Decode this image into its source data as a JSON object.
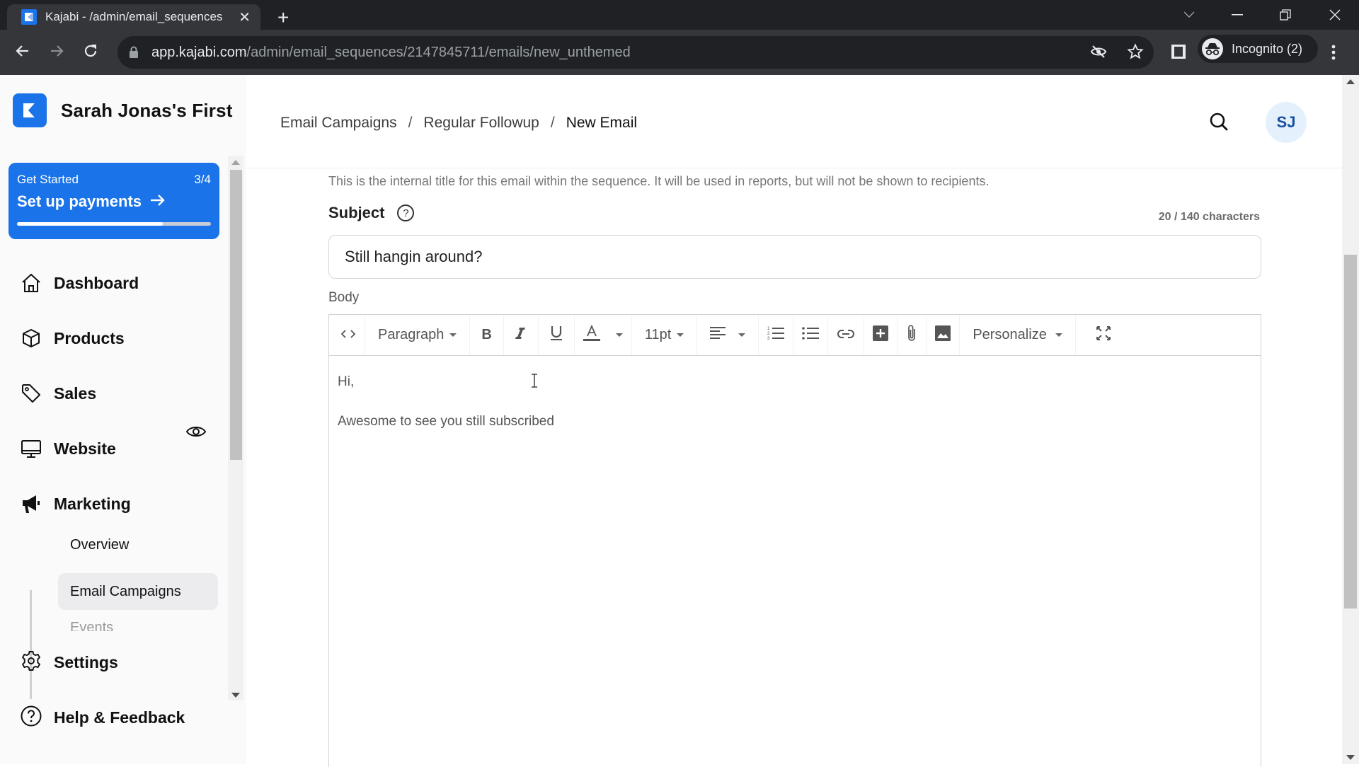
{
  "browser": {
    "tab_title": "Kajabi - /admin/email_sequences",
    "url_host": "app.kajabi.com",
    "url_path": "/admin/email_sequences/2147845711/emails/new_unthemed",
    "profile_label": "Incognito (2)"
  },
  "sidebar": {
    "brand_name": "Sarah Jonas's First",
    "onboarding": {
      "label": "Get Started",
      "count": "3/4",
      "cta": "Set up payments",
      "progress": 0.75
    },
    "items": [
      {
        "label": "Dashboard",
        "icon": "home-icon"
      },
      {
        "label": "Products",
        "icon": "box-icon"
      },
      {
        "label": "Sales",
        "icon": "tag-icon"
      },
      {
        "label": "Website",
        "icon": "monitor-icon"
      },
      {
        "label": "Marketing",
        "icon": "megaphone-icon"
      }
    ],
    "marketing_sub": [
      {
        "label": "Overview",
        "active": false
      },
      {
        "label": "Email Campaigns",
        "active": true
      },
      {
        "label": "Events",
        "active": false
      }
    ],
    "bottom": [
      {
        "label": "Settings",
        "icon": "gear-icon"
      },
      {
        "label": "Help & Feedback",
        "icon": "help-icon"
      }
    ]
  },
  "header": {
    "breadcrumbs": [
      "Email Campaigns",
      "Regular Followup",
      "New Email"
    ],
    "separator": "/",
    "avatar_initials": "SJ"
  },
  "form": {
    "title_hint": "This is the internal title for this email within the sequence. It will be used in reports, but will not be shown to recipients.",
    "subject_label": "Subject",
    "char_count": "20 / 140 characters",
    "subject_value": "Still hangin around?",
    "body_label": "Body",
    "toolbar": {
      "block_format": "Paragraph",
      "font_size": "11pt",
      "personalize": "Personalize"
    },
    "body_lines": [
      "Hi,",
      "Awesome to see you still subscribed"
    ]
  },
  "colors": {
    "brand": "#1a73e8",
    "avatar_bg": "#e4f1fc",
    "avatar_text": "#1a4fa0"
  }
}
